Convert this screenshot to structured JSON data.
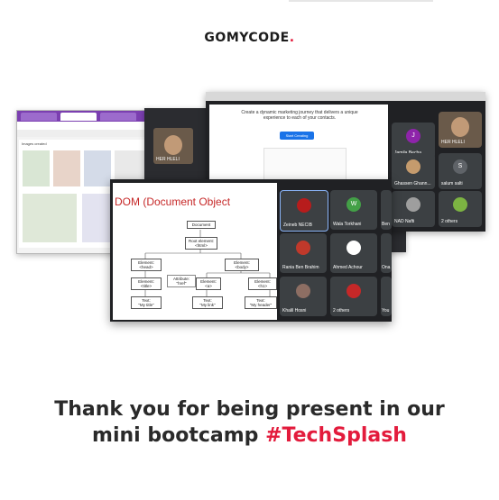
{
  "brand": {
    "name": "GOMYCODE",
    "suffix": ".",
    "accent": "#e31b3c"
  },
  "screen_browser": {
    "spreadsheet_title": "Images created",
    "tab_color": "#7b3fb0",
    "camera_label": "HER HLELI"
  },
  "screen_meet_top": {
    "shared_headline": "Create a dynamic marketing journey that delivers a unique experience to each of your contacts.",
    "shared_button": "Start Creating",
    "participants": [
      {
        "name": "HER HLELI",
        "initial": "",
        "color": "#6a5a4a"
      },
      {
        "name": "Jamila Becha",
        "initial": "J",
        "color": "#8e24aa"
      },
      {
        "name": "Ghassen Ghann...",
        "initial": "",
        "color": "#c59b6d"
      },
      {
        "name": "salum salti",
        "initial": "S",
        "color": "#5f6368"
      },
      {
        "name": "NAD Nafti",
        "initial": "",
        "color": "#9e9e9e"
      },
      {
        "name": "2 others",
        "initial": "",
        "color": "#7cb342"
      }
    ]
  },
  "screen_front": {
    "slide_title": "DOM (Document Object",
    "tree": {
      "root": "Document",
      "root_element": "Root element:\n<html>",
      "head": "Element:\n<head>",
      "body": "Element:\n<body>",
      "title": "Element:\n<title>",
      "attribute": "Attribute:\n\"href\"",
      "a": "Element:\n<a>",
      "h1": "Element:\n<h1>",
      "text_title": "Text:\n\"My title\"",
      "text_link": "Text:\n\"My link\"",
      "text_header": "Text:\n\"My header\""
    },
    "participants": [
      {
        "name": "Zeineb NECIB",
        "initial": "",
        "color": "#b71c1c"
      },
      {
        "name": "Wala Torkhani",
        "initial": "W",
        "color": "#43a047"
      },
      {
        "name": "Ben",
        "initial": "",
        "color": "#3c4043"
      },
      {
        "name": "Rania Ben Brahim",
        "initial": "",
        "color": "#c0392b"
      },
      {
        "name": "Ahmed Achour",
        "initial": "",
        "color": "#ffffff"
      },
      {
        "name": "Ona",
        "initial": "",
        "color": "#3c4043"
      },
      {
        "name": "Khalil Hosni",
        "initial": "",
        "color": "#8d6e63"
      },
      {
        "name": "2 others",
        "initial": "",
        "color": "#c62828"
      },
      {
        "name": "You",
        "initial": "",
        "color": "#3c4043"
      }
    ]
  },
  "message": {
    "line1": "Thank you for being present in our",
    "line2_prefix": "mini bootcamp ",
    "hashtag": "#TechSplash"
  }
}
